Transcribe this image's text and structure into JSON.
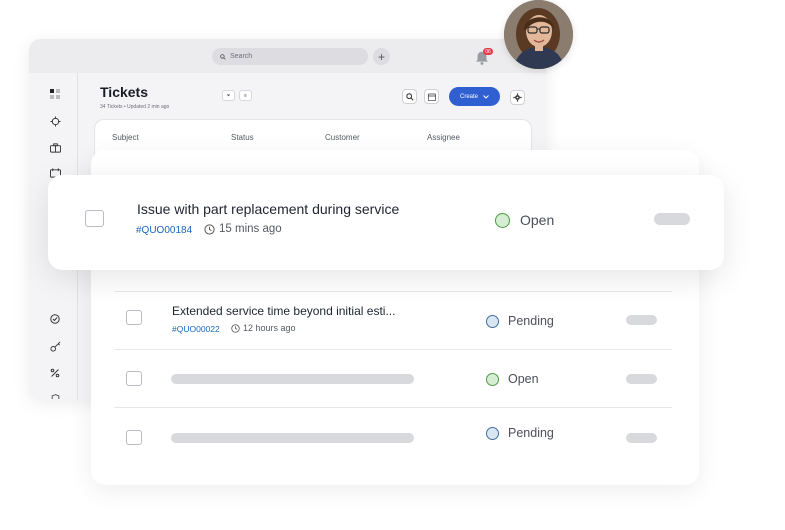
{
  "topbar": {
    "search_placeholder": "Search",
    "add_label": "+",
    "notification_count": "06"
  },
  "page": {
    "title": "Tickets",
    "subtitle": "34 Tickets • Updated 2 min ago"
  },
  "toolbar": {
    "create_label": "Create"
  },
  "table": {
    "columns": [
      "Subject",
      "Status",
      "Customer",
      "Assignee"
    ]
  },
  "rows": [
    {
      "subject": "Issue with part replacement during service",
      "id": "#QUO00184",
      "time": "15 mins ago",
      "status": "Open"
    },
    {
      "subject": "Extended service time beyond initial esti...",
      "id": "#QUO00022",
      "time": "12 hours ago",
      "status": "Pending"
    },
    {
      "status": "Open"
    },
    {
      "status": "Pending"
    }
  ],
  "colors": {
    "accent": "#2f5fd0",
    "id_link": "#1a64c2",
    "open_dot": "#4c9a44",
    "pending_dot": "#436d9c",
    "badge": "#e5394a"
  }
}
